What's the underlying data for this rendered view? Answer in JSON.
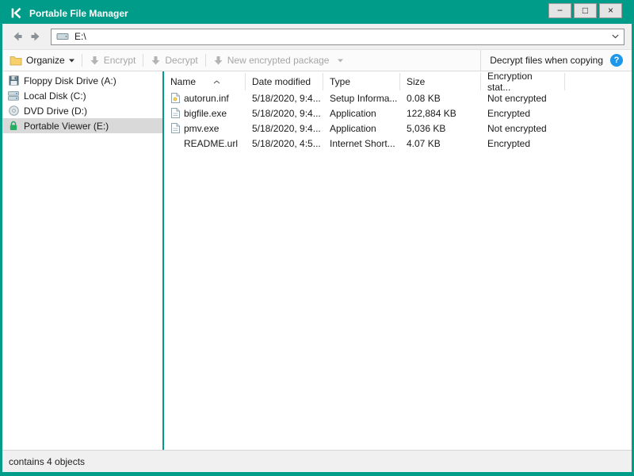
{
  "colors": {
    "brand_green": "#009c8a",
    "help_blue": "#1e97ea",
    "selection_gray": "#d9d9d9",
    "disabled_text": "#a6a6a6"
  },
  "window": {
    "title": "Portable File Manager",
    "controls": {
      "minimize": "−",
      "maximize": "□",
      "close": "×"
    }
  },
  "navbar": {
    "address": "E:\\"
  },
  "toolbar": {
    "organize_label": "Organize",
    "encrypt_label": "Encrypt",
    "decrypt_label": "Decrypt",
    "new_package_label": "New encrypted package",
    "decrypt_copy_label": "Decrypt files when copying",
    "help_glyph": "?"
  },
  "sidebar": {
    "items": [
      {
        "label": "Floppy Disk Drive (A:)",
        "icon": "floppy-drive-icon",
        "selected": false
      },
      {
        "label": "Local Disk (C:)",
        "icon": "local-disk-icon",
        "selected": false
      },
      {
        "label": "DVD Drive (D:)",
        "icon": "dvd-drive-icon",
        "selected": false
      },
      {
        "label": "Portable Viewer (E:)",
        "icon": "encrypted-drive-lock-icon",
        "selected": true
      }
    ]
  },
  "filelist": {
    "columns": [
      "Name",
      "Date modified",
      "Type",
      "Size",
      "Encryption stat..."
    ],
    "rows": [
      {
        "name": "autorun.inf",
        "date_modified": "5/18/2020, 9:4...",
        "type": "Setup Informa...",
        "size": "0.08 KB",
        "encryption_status": "Not encrypted",
        "icon": "setup-information-file-icon"
      },
      {
        "name": "bigfile.exe",
        "date_modified": "5/18/2020, 9:4...",
        "type": "Application",
        "size": "122,884 KB",
        "encryption_status": "Encrypted",
        "icon": "application-file-icon"
      },
      {
        "name": "pmv.exe",
        "date_modified": "5/18/2020, 9:4...",
        "type": "Application",
        "size": "5,036 KB",
        "encryption_status": "Not encrypted",
        "icon": "application-file-icon"
      },
      {
        "name": "README.url",
        "date_modified": "5/18/2020, 4:5...",
        "type": "Internet Short...",
        "size": "4.07 KB",
        "encryption_status": "Encrypted",
        "icon": "none"
      }
    ]
  },
  "statusbar": {
    "text": "contains 4 objects"
  }
}
